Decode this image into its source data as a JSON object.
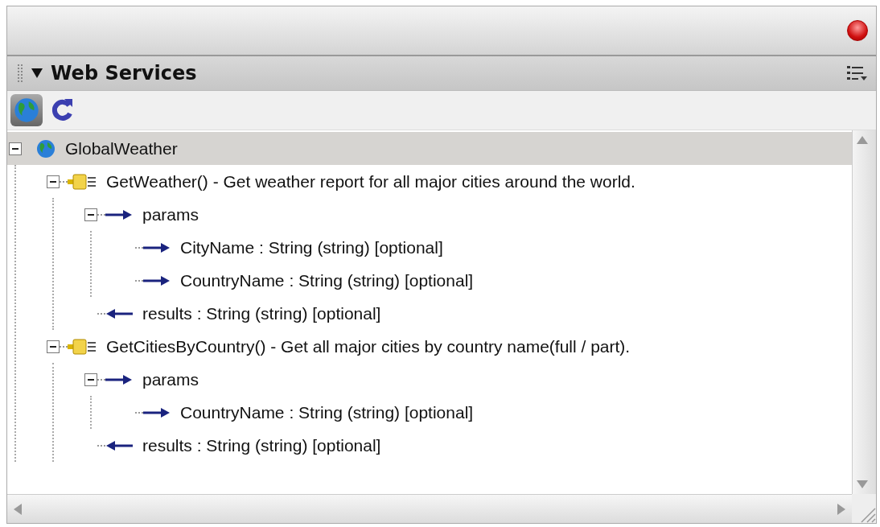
{
  "panel": {
    "title": "Web Services",
    "expanded": true
  },
  "tree": [
    {
      "kind": "service",
      "label": "GlobalWeather",
      "selected": true,
      "expanded": true,
      "children": [
        {
          "kind": "operation",
          "label": "GetWeather() - Get weather report for all major cities around the world.",
          "selected": false,
          "expanded": true,
          "children": [
            {
              "kind": "params",
              "label": "params",
              "selected": false,
              "expanded": true,
              "children": [
                {
                  "kind": "param",
                  "label": "CityName : String (string) [optional]",
                  "selected": false
                },
                {
                  "kind": "param",
                  "label": "CountryName : String (string) [optional]",
                  "selected": false
                }
              ]
            },
            {
              "kind": "result",
              "label": "results : String (string) [optional]",
              "selected": false
            }
          ]
        },
        {
          "kind": "operation",
          "label": "GetCitiesByCountry() - Get all major cities by country name(full / part).",
          "selected": false,
          "expanded": true,
          "children": [
            {
              "kind": "params",
              "label": "params",
              "selected": false,
              "expanded": true,
              "children": [
                {
                  "kind": "param",
                  "label": "CountryName : String (string) [optional]",
                  "selected": false
                }
              ]
            },
            {
              "kind": "result",
              "label": "results : String (string) [optional]",
              "selected": false
            }
          ]
        }
      ]
    }
  ]
}
